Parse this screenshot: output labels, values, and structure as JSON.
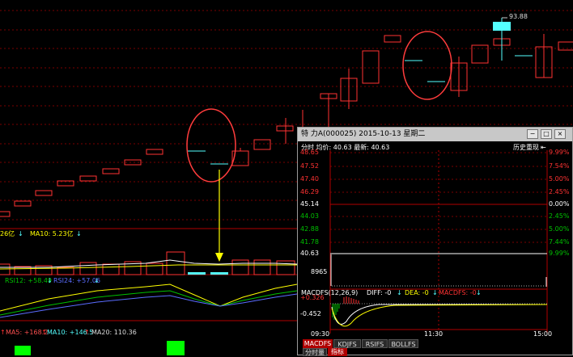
{
  "main_chart": {
    "peak_price_label": "93.88",
    "vol_text_1": "26亿",
    "vol_text_2": "MA10: 5.23亿",
    "rsi_text_1": "RSI12: +58.49",
    "rsi_text_2": "RSI24: +57.06",
    "ma_text_1": "MA5: +168.2",
    "ma_text_2": "MA10: +146.5",
    "ma_text_3": "MA20: 110.36",
    "colors": {
      "up": "#ff3232",
      "flat": "#54ffff",
      "ma_line": "#ffffff",
      "arrow": "#ffff00",
      "highlight_circle": "#ff3c3c"
    }
  },
  "popup": {
    "title": "特  力A(000025) 2015-10-13 星期二",
    "header_left": "分时 均价: 40.63 最新: 40.63",
    "header_right": "历史重现",
    "price_labels": [
      "48.65",
      "47.52",
      "47.40",
      "46.29",
      "45.14",
      "44.03",
      "42.88",
      "41.78",
      "40.63"
    ],
    "pct_labels": [
      "9.99%",
      "7.54%",
      "5.00%",
      "2.45%",
      "0.00%",
      "2.45%",
      "5.00%",
      "7.44%",
      "9.99%"
    ],
    "volume_label": "8965",
    "macd_header": {
      "name": "MACDFS(12,26,9)",
      "diff": "DIFF: -0",
      "dea": "DEA: -0",
      "macdfs": "MACDFS: -0"
    },
    "macd_levels": [
      "+0.326",
      "-0.452"
    ],
    "time_labels": [
      "09:30",
      "11:30",
      "15:00"
    ],
    "indicator_tabs": [
      "MACDFS",
      "KDJFS",
      "RSIFS",
      "BOLLFS"
    ],
    "bottom_tabs": [
      "分时量",
      "指标"
    ],
    "window_buttons": [
      "−",
      "□",
      "×"
    ]
  }
}
